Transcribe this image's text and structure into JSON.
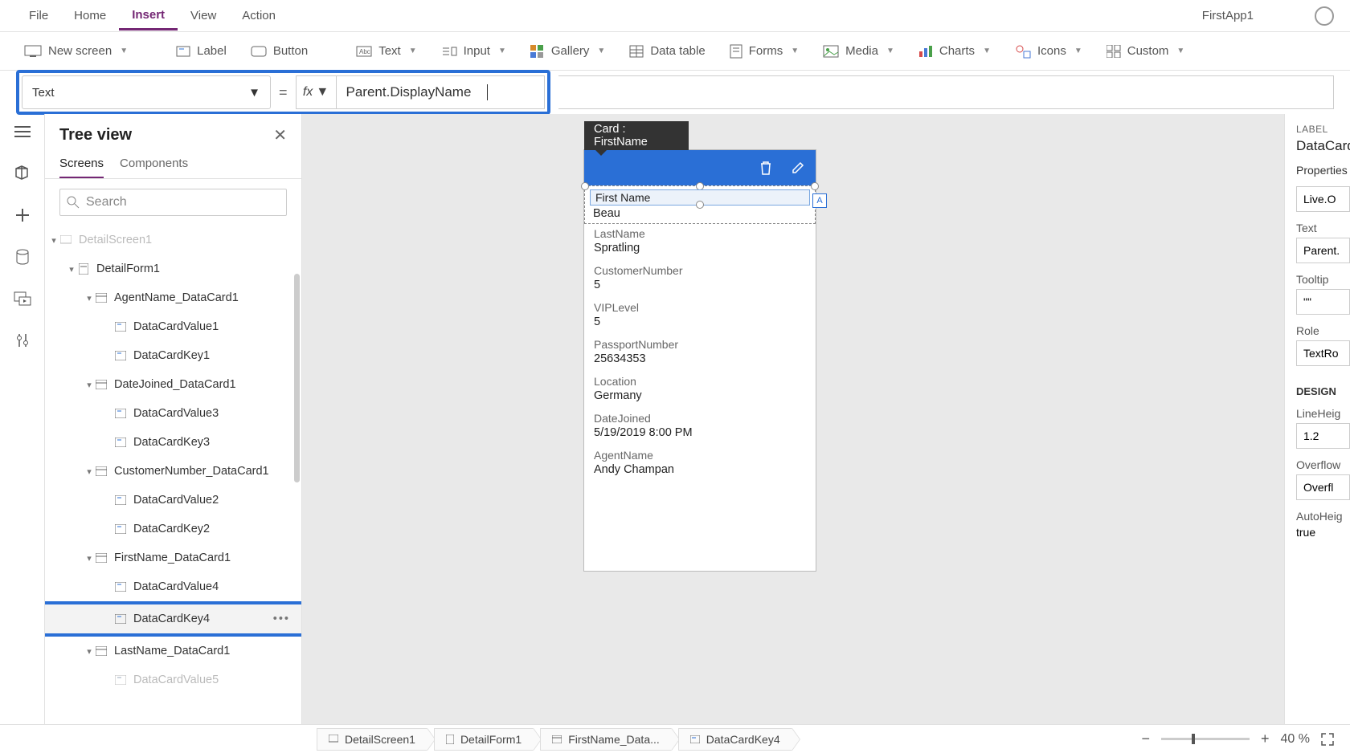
{
  "app_name": "FirstApp1",
  "menu": {
    "file": "File",
    "home": "Home",
    "insert": "Insert",
    "view": "View",
    "action": "Action"
  },
  "ribbon": {
    "new_screen": "New screen",
    "label": "Label",
    "button": "Button",
    "text": "Text",
    "input": "Input",
    "gallery": "Gallery",
    "data_table": "Data table",
    "forms": "Forms",
    "media": "Media",
    "charts": "Charts",
    "icons": "Icons",
    "custom": "Custom"
  },
  "formula": {
    "property": "Text",
    "fx": "fx",
    "value": "Parent.DisplayName"
  },
  "tree": {
    "title": "Tree view",
    "tab_screens": "Screens",
    "tab_components": "Components",
    "search_placeholder": "Search",
    "nodes": {
      "detail_screen": "DetailScreen1",
      "detail_form": "DetailForm1",
      "agent_card": "AgentName_DataCard1",
      "dcval1": "DataCardValue1",
      "dckey1": "DataCardKey1",
      "date_card": "DateJoined_DataCard1",
      "dcval3": "DataCardValue3",
      "dckey3": "DataCardKey3",
      "cust_card": "CustomerNumber_DataCard1",
      "dcval2": "DataCardValue2",
      "dckey2": "DataCardKey2",
      "first_card": "FirstName_DataCard1",
      "dcval4": "DataCardValue4",
      "dckey4": "DataCardKey4",
      "last_card": "LastName_DataCard1",
      "dcval5": "DataCardValue5"
    }
  },
  "card": {
    "header": "Card : FirstName",
    "fields": {
      "first_name_l": "First Name",
      "first_name_v": "Beau",
      "last_name_l": "LastName",
      "last_name_v": "Spratling",
      "cust_l": "CustomerNumber",
      "cust_v": "5",
      "vip_l": "VIPLevel",
      "vip_v": "5",
      "pass_l": "PassportNumber",
      "pass_v": "25634353",
      "loc_l": "Location",
      "loc_v": "Germany",
      "date_l": "DateJoined",
      "date_v": "5/19/2019 8:00 PM",
      "agent_l": "AgentName",
      "agent_v": "Andy Champan"
    }
  },
  "props": {
    "type": "LABEL",
    "name": "DataCard",
    "tab": "Properties",
    "live_l": "",
    "live_v": "Live.O",
    "text_l": "Text",
    "text_v": "Parent.",
    "tooltip_l": "Tooltip",
    "tooltip_v": "\"\"",
    "role_l": "Role",
    "role_v": "TextRo",
    "design": "DESIGN",
    "lh_l": "LineHeig",
    "lh_v": "1.2",
    "of_l": "Overflow",
    "of_v": "Overfl",
    "ah_l": "AutoHeig",
    "ah_v": "true"
  },
  "breadcrumb": {
    "b1": "DetailScreen1",
    "b2": "DetailForm1",
    "b3": "FirstName_Data...",
    "b4": "DataCardKey4"
  },
  "zoom": {
    "pct": "40",
    "unit": "%"
  }
}
